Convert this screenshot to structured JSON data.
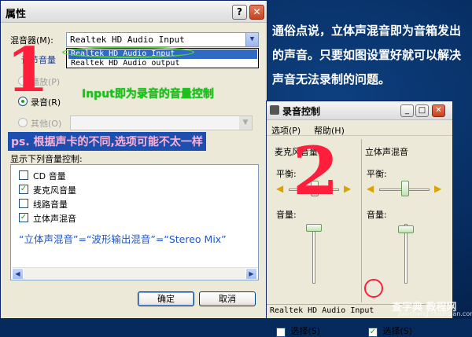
{
  "properties_dialog": {
    "title": "属性",
    "help_label": "?",
    "close_label": "✕",
    "mixer_label": "混音器(M):",
    "mixer_value": "Realtek HD Audio Input",
    "mixer_options": [
      "Realtek HD Audio Input",
      "Realtek HD Audio output"
    ],
    "adjust_volume_label": "调节音量",
    "radio_playback": "播放(P)",
    "radio_recording": "录音(R)",
    "radio_other": "其他(O)",
    "show_controls_label": "显示下列音量控制:",
    "controls": [
      {
        "label": "CD 音量",
        "checked": false
      },
      {
        "label": "麦克风音量",
        "checked": true
      },
      {
        "label": "线路音量",
        "checked": false
      },
      {
        "label": "立体声混音",
        "checked": true
      }
    ],
    "mix_note": "“立体声混音”=“波形输出混音”=“Stereo Mix”",
    "ok_label": "确定",
    "cancel_label": "取消"
  },
  "annotations": {
    "input_note": "Input即为录音的音量控制",
    "ps_note": "ps. 根据声卡的不同,选项可能不太一样",
    "step1": "1",
    "step2": "2",
    "explanation": "通俗点说，立体声混音即为音箱发出的声音。只要如图设置好就可以解决声音无法录制的问题。"
  },
  "recording_control": {
    "title": "录音控制",
    "menu_options": "选项(P)",
    "menu_help": "帮助(H)",
    "columns": [
      {
        "name": "麦克风音量",
        "balance_label": "平衡:",
        "volume_label": "音量:",
        "select_label": "选择(S)",
        "selected": false
      },
      {
        "name": "立体声混音",
        "balance_label": "平衡:",
        "volume_label": "音量:",
        "select_label": "选择(S)",
        "selected": true
      }
    ],
    "status": "Realtek HD Audio Input"
  },
  "watermark": {
    "text": "查字典 教程网",
    "url": "jiaocheng.chazidian.com"
  },
  "colors": {
    "accent_red": "#ff1e3c",
    "accent_green": "#1bc11b",
    "note_blue": "#1e56c8",
    "background": "#062a5c"
  }
}
